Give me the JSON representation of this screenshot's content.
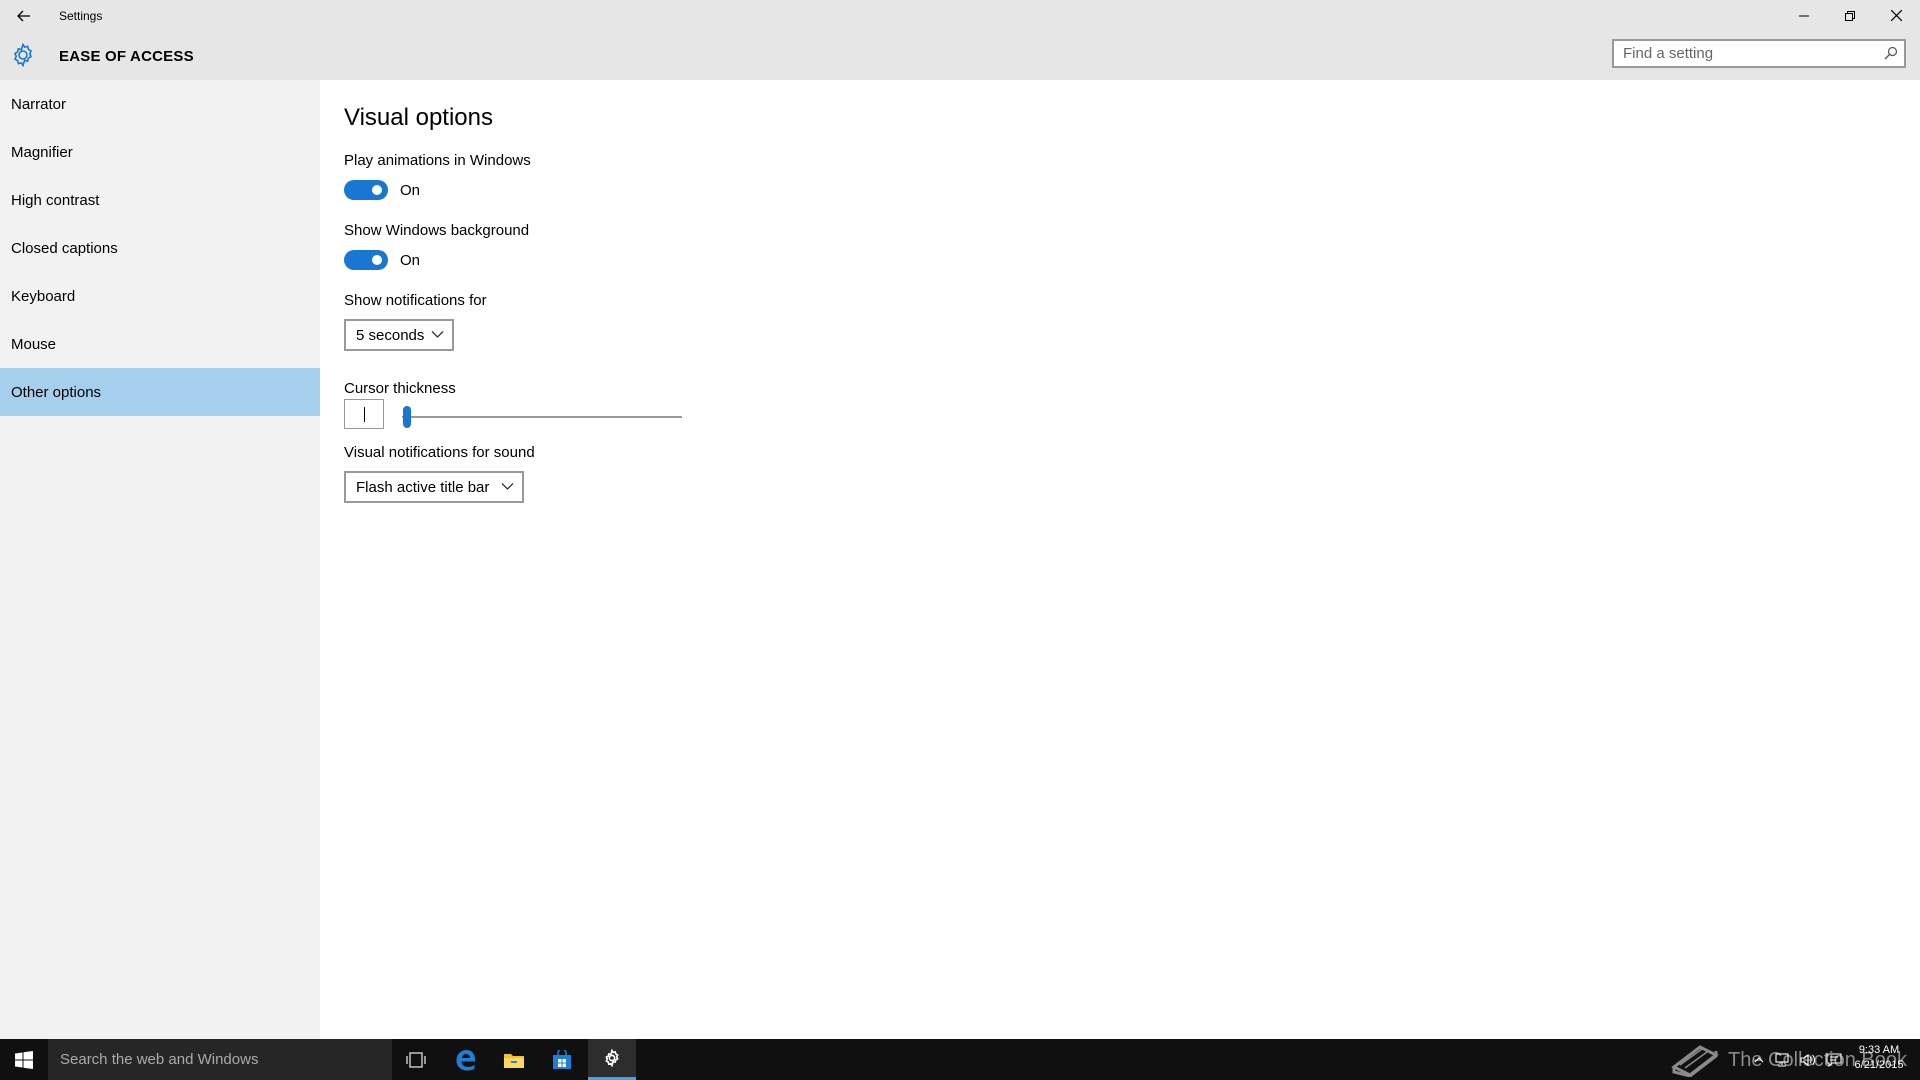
{
  "window": {
    "title": "Settings",
    "controls": [
      "minimize",
      "restore",
      "close"
    ]
  },
  "header": {
    "title": "EASE OF ACCESS",
    "icon": "gear-icon",
    "search_placeholder": "Find a setting"
  },
  "sidebar": {
    "items": [
      {
        "label": "Narrator",
        "selected": false
      },
      {
        "label": "Magnifier",
        "selected": false
      },
      {
        "label": "High contrast",
        "selected": false
      },
      {
        "label": "Closed captions",
        "selected": false
      },
      {
        "label": "Keyboard",
        "selected": false
      },
      {
        "label": "Mouse",
        "selected": false
      },
      {
        "label": "Other options",
        "selected": true
      }
    ],
    "selected_color": "#a6cfee"
  },
  "main": {
    "section_title": "Visual options",
    "play_animations": {
      "label": "Play animations in Windows",
      "state": "On",
      "enabled": true
    },
    "show_background": {
      "label": "Show Windows background",
      "state": "On",
      "enabled": true
    },
    "notifications": {
      "label": "Show notifications for",
      "value": "5 seconds"
    },
    "cursor_thickness": {
      "label": "Cursor thickness",
      "value": 1
    },
    "visual_notifications": {
      "label": "Visual notifications for sound",
      "value": "Flash active title bar"
    },
    "accent_color": "#1976d2"
  },
  "taskbar": {
    "search_placeholder": "Search the web and Windows",
    "watermark": "The Collection Book",
    "clock_time": "9:33 AM",
    "clock_date": "6/21/2015",
    "pinned": [
      "task-view-icon",
      "edge-icon",
      "file-explorer-icon",
      "store-icon",
      "settings-icon"
    ]
  }
}
